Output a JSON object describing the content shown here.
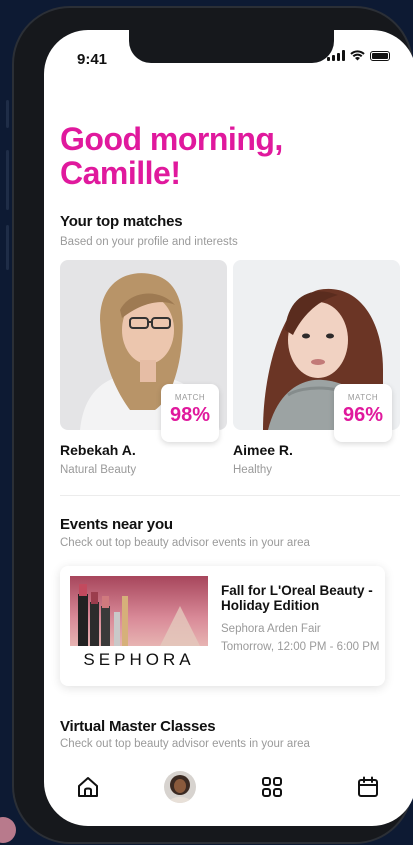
{
  "status_bar": {
    "time": "9:41"
  },
  "greeting": {
    "line1": "Good morning,",
    "line2": "Camille!"
  },
  "top_matches": {
    "title": "Your top matches",
    "subtitle": "Based on your profile and interests",
    "badge_label": "MATCH",
    "items": [
      {
        "name": "Rebekah A.",
        "tag": "Natural Beauty",
        "match": "98%"
      },
      {
        "name": "Aimee R.",
        "tag": "Healthy",
        "match": "96%"
      }
    ]
  },
  "events": {
    "title": "Events near you",
    "subtitle": "Check out top beauty advisor events in your area",
    "items": [
      {
        "brand": "SEPHORA",
        "title": "Fall for L'Oreal Beauty - Holiday Edition",
        "location": "Sephora Arden Fair",
        "time": "Tomorrow, 12:00 PM - 6:00 PM"
      }
    ]
  },
  "classes": {
    "title": "Virtual Master Classes",
    "subtitle": "Check out top beauty advisor events in your area"
  },
  "tabbar": {
    "tabs": [
      {
        "icon": "home-icon"
      },
      {
        "icon": "profile-avatar"
      },
      {
        "icon": "grid-icon"
      },
      {
        "icon": "calendar-icon"
      }
    ]
  },
  "colors": {
    "accent": "#e0199d",
    "background": "#0d1a33",
    "muted": "#9a9a9a"
  }
}
